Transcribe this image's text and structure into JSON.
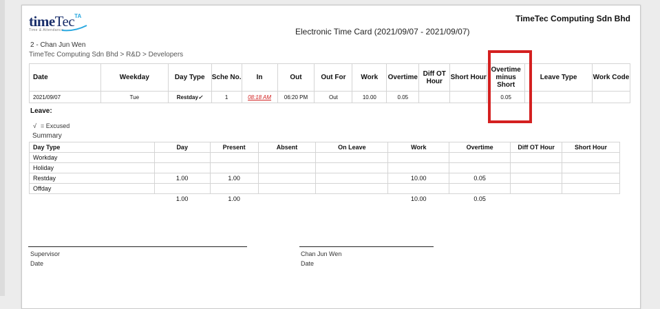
{
  "header": {
    "logo_main": "time",
    "logo_accent": "Tec",
    "logo_sup": "TA",
    "logo_tagline": "Time & Attendance",
    "company": "TimeTec Computing Sdn Bhd",
    "title": "Electronic Time Card",
    "date_range": "(2021/09/07 - 2021/09/07)",
    "employee": "2 - Chan Jun Wen",
    "breadcrumb": "TimeTec Computing Sdn Bhd > R&D > Developers"
  },
  "timecard": {
    "columns": [
      "Date",
      "Weekday",
      "Day Type",
      "Sche No.",
      "In",
      "Out",
      "Out For",
      "Work",
      "Overtime",
      "Diff OT Hour",
      "Short Hour",
      "Overtime minus Short",
      "Leave Type",
      "Work Code"
    ],
    "rows": [
      {
        "date": "2021/09/07",
        "weekday": "Tue",
        "day_type": "Restday",
        "day_type_mark": "✓",
        "sche_no": "1",
        "in": "08:18 AM",
        "out": "06:20 PM",
        "out_for": "Out",
        "work": "10.00",
        "overtime": "0.05",
        "diff_ot": "",
        "short_hour": "",
        "ot_minus_short": "0.05",
        "leave_type": "",
        "work_code": ""
      }
    ]
  },
  "leave_label": "Leave:",
  "legend": {
    "tick": "√",
    "text": "= Excused"
  },
  "summary": {
    "label": "Summary",
    "columns": [
      "Day Type",
      "Day",
      "Present",
      "Absent",
      "On Leave",
      "Work",
      "Overtime",
      "Diff OT Hour",
      "Short Hour"
    ],
    "rows": [
      [
        "Workday",
        "",
        "",
        "",
        "",
        "",
        "",
        "",
        ""
      ],
      [
        "Holiday",
        "",
        "",
        "",
        "",
        "",
        "",
        "",
        ""
      ],
      [
        "Restday",
        "1.00",
        "1.00",
        "",
        "",
        "10.00",
        "0.05",
        "",
        ""
      ],
      [
        "Offday",
        "",
        "",
        "",
        "",
        "",
        "",
        "",
        ""
      ]
    ],
    "totals": [
      "",
      "1.00",
      "1.00",
      "",
      "",
      "10.00",
      "0.05",
      "",
      ""
    ]
  },
  "signatures": {
    "left_role": "Supervisor",
    "left_date": "Date",
    "right_name": "Chan Jun Wen",
    "right_date": "Date"
  },
  "colors": {
    "highlight": "#d42020",
    "late": "#d12020",
    "brand": "#1a2f6b"
  }
}
